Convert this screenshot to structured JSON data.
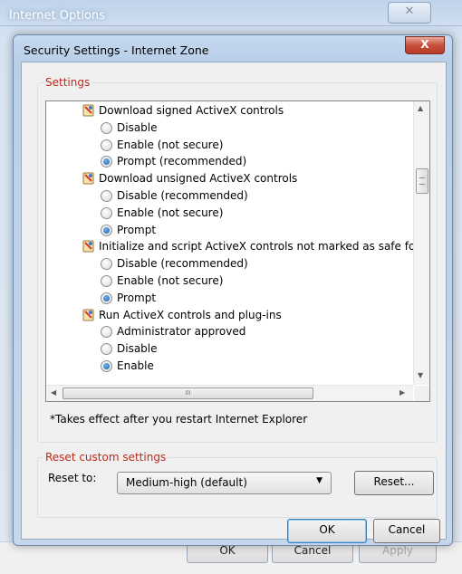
{
  "background_window": {
    "title": "Internet Options",
    "close_glyph": "✕",
    "buttons": {
      "ok": "OK",
      "cancel": "Cancel",
      "apply": "Apply"
    }
  },
  "dialog": {
    "title": "Security Settings - Internet Zone",
    "close_glyph": "X",
    "settings_legend": "Settings",
    "items": [
      {
        "type": "category",
        "label": "Download signed ActiveX controls"
      },
      {
        "type": "option",
        "label": "Disable",
        "checked": false
      },
      {
        "type": "option",
        "label": "Enable (not secure)",
        "checked": false
      },
      {
        "type": "option",
        "label": "Prompt (recommended)",
        "checked": true
      },
      {
        "type": "category",
        "label": "Download unsigned ActiveX controls"
      },
      {
        "type": "option",
        "label": "Disable (recommended)",
        "checked": false
      },
      {
        "type": "option",
        "label": "Enable (not secure)",
        "checked": false
      },
      {
        "type": "option",
        "label": "Prompt",
        "checked": true
      },
      {
        "type": "category",
        "label": "Initialize and script ActiveX controls not marked as safe for sc"
      },
      {
        "type": "option",
        "label": "Disable (recommended)",
        "checked": false
      },
      {
        "type": "option",
        "label": "Enable (not secure)",
        "checked": false
      },
      {
        "type": "option",
        "label": "Prompt",
        "checked": true
      },
      {
        "type": "category",
        "label": "Run ActiveX controls and plug-ins"
      },
      {
        "type": "option",
        "label": "Administrator approved",
        "checked": false
      },
      {
        "type": "option",
        "label": "Disable",
        "checked": false
      },
      {
        "type": "option",
        "label": "Enable",
        "checked": true
      }
    ],
    "hscroll_grip": "III",
    "note": "*Takes effect after you restart Internet Explorer",
    "reset": {
      "legend": "Reset custom settings",
      "label": "Reset to:",
      "selected": "Medium-high (default)",
      "button": "Reset..."
    },
    "buttons": {
      "ok": "OK",
      "cancel": "Cancel"
    }
  },
  "colors": {
    "legend_text": "#c0281b",
    "radio_fill": "#1f5fa8",
    "close_button": "#c7503b"
  }
}
